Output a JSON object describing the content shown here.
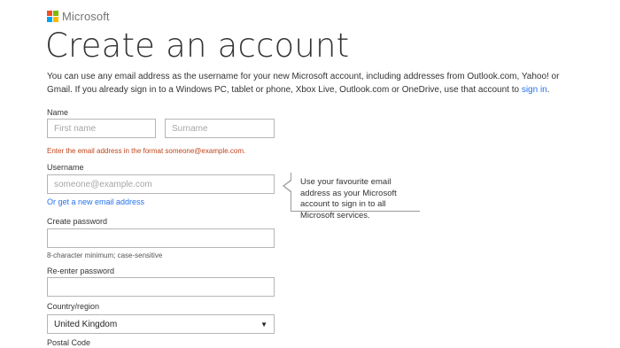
{
  "brand": {
    "name": "Microsoft",
    "logo_colors": [
      "#f25022",
      "#7fba00",
      "#00a4ef",
      "#ffb900"
    ]
  },
  "page": {
    "title": "Create an account",
    "intro_text": "You can use any email address as the username for your new Microsoft account, including addresses from Outlook.com, Yahoo! or Gmail. If you already sign in to a Windows PC, tablet or phone, Xbox Live, Outlook.com or OneDrive, use that account to ",
    "intro_link": "sign in",
    "intro_end": "."
  },
  "form": {
    "name_label": "Name",
    "first_name_placeholder": "First name",
    "surname_placeholder": "Surname",
    "email_error": "Enter the email address in the format someone@example.com.",
    "username_label": "Username",
    "username_placeholder": "someone@example.com",
    "new_email_link": "Or get a new email address",
    "create_password_label": "Create password",
    "password_hint": "8-character minimum; case-sensitive",
    "reenter_password_label": "Re-enter password",
    "country_label": "Country/region",
    "country_value": "United Kingdom",
    "postal_code_label": "Postal Code"
  },
  "tooltip": {
    "text": "Use your favourite email address as your Microsoft account to sign in to all Microsoft services."
  },
  "colors": {
    "link": "#2672ec",
    "error": "#c0441a"
  }
}
